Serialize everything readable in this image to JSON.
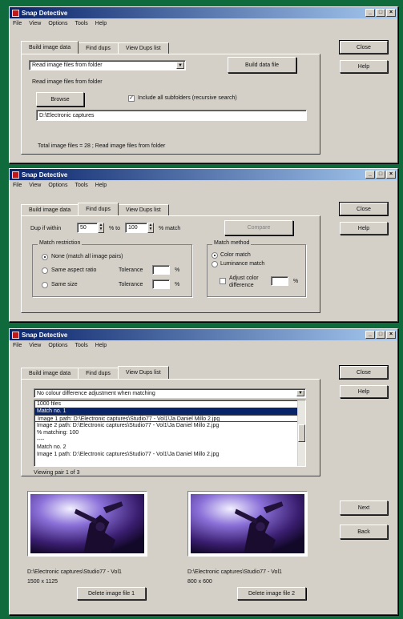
{
  "app": {
    "title": "Snap Detective"
  },
  "window_buttons": [
    "_",
    "□",
    "×"
  ],
  "menu": [
    "File",
    "View",
    "Options",
    "Tools",
    "Help"
  ],
  "tabs": [
    "Build image data",
    "Find dups",
    "View Dups list"
  ],
  "side_buttons": {
    "close": "Close",
    "help": "Help"
  },
  "win1": {
    "source_dropdown": "Read image files from folder",
    "build_button": "Build data file",
    "group_label": "Read image files from folder",
    "browse_button": "Browse",
    "include_subfolders": "Include all subfolders (recursive search)",
    "path_value": "D:\\Electronic captures",
    "status": "Total image files = 28 ; Read image files from folder"
  },
  "win2": {
    "dup_within_label": "Dup if within",
    "dup_from": "50",
    "to_label": "% to",
    "dup_to": "100",
    "match_label": "% match",
    "compare_button": "Compare",
    "match_restriction": "Match restriction",
    "opt_none": "None (match all image pairs)",
    "opt_aspect": "Same aspect ratio",
    "opt_size": "Same size",
    "tolerance_label": "Tolerance",
    "tol_aspect": "",
    "tol_size": "",
    "pct": "%",
    "match_method": "Match method",
    "method_color": "Color match",
    "method_lum": "Luminance match",
    "adjust_label": "Adjust color difference",
    "adjust_value": ""
  },
  "win3": {
    "filter_dropdown": "No colour difference adjustment when matching",
    "list_rows": [
      "1000 files",
      "Match no. 1",
      "Image 1 path: D:\\Electronic captures\\Studio77 - Vol1\\Ja Daniel Millo 2.jpg",
      "Image 2 path: D:\\Electronic captures\\Studio77 - Vol1\\Ja Daniel Millo 2.jpg",
      "% matching: 100",
      "----",
      "Match no. 2",
      "Image 1 path: D:\\Electronic captures\\Studio77 - Vol1\\Ja Daniel Millo 2.jpg"
    ],
    "viewing": "Viewing pair 1 of 3",
    "next_button": "Next",
    "back_button": "Back",
    "img1_path": "D:\\Electronic captures\\Studio77 - Vol1",
    "img1_size": "1500 x 1125",
    "img2_path": "D:\\Electronic captures\\Studio77 - Vol1",
    "img2_size": "800 x 600",
    "delete1": "Delete image file 1",
    "delete2": "Delete image file 2"
  },
  "colors": {
    "background": "#0f6b3c",
    "titlebar": "#0a246a",
    "window": "#d4d0c8",
    "selection": "#0a246a"
  }
}
